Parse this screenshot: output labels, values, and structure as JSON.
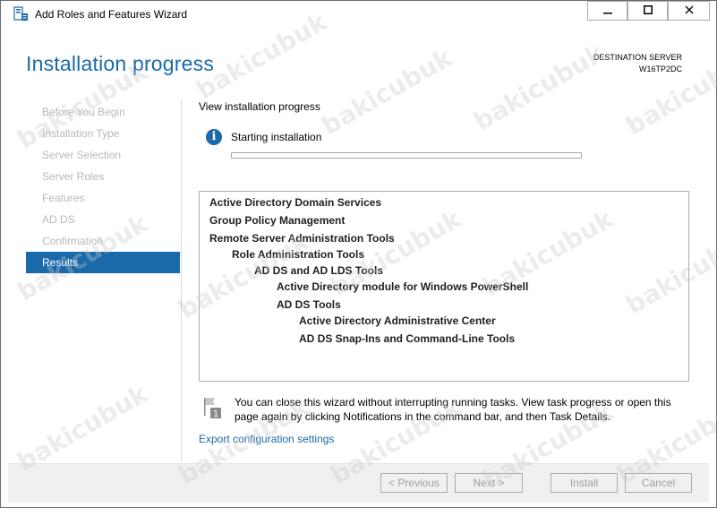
{
  "window": {
    "title": "Add Roles and Features Wizard",
    "minimize_icon": "minimize-icon",
    "maximize_icon": "maximize-icon",
    "close_icon": "close-icon"
  },
  "header": {
    "page_title": "Installation progress",
    "destination_label": "DESTINATION SERVER",
    "destination_server": "W16TP2DC"
  },
  "nav": {
    "items": [
      {
        "label": "Before You Begin",
        "active": false
      },
      {
        "label": "Installation Type",
        "active": false
      },
      {
        "label": "Server Selection",
        "active": false
      },
      {
        "label": "Server Roles",
        "active": false
      },
      {
        "label": "Features",
        "active": false
      },
      {
        "label": "AD DS",
        "active": false
      },
      {
        "label": "Confirmation",
        "active": false
      },
      {
        "label": "Results",
        "active": true
      }
    ]
  },
  "main": {
    "view_label": "View installation progress",
    "status_text": "Starting installation",
    "progress": 0.0,
    "features": [
      {
        "label": "Active Directory Domain Services",
        "level": 0
      },
      {
        "label": "Group Policy Management",
        "level": 0
      },
      {
        "label": "Remote Server Administration Tools",
        "level": 0
      },
      {
        "label": "Role Administration Tools",
        "level": 1
      },
      {
        "label": "AD DS and AD LDS Tools",
        "level": 2
      },
      {
        "label": "Active Directory module for Windows PowerShell",
        "level": 3
      },
      {
        "label": "AD DS Tools",
        "level": 3
      },
      {
        "label": "Active Directory Administrative Center",
        "level": 4
      },
      {
        "label": "AD DS Snap-Ins and Command-Line Tools",
        "level": 4
      }
    ],
    "notice_text": "You can close this wizard without interrupting running tasks. View task progress or open this page again by clicking Notifications in the command bar, and then Task Details.",
    "notice_badge": "1",
    "export_link": "Export configuration settings"
  },
  "footer": {
    "previous_label": "< Previous",
    "next_label": "Next >",
    "install_label": "Install",
    "cancel_label": "Cancel"
  },
  "watermark": "bakicubuk",
  "colors": {
    "accent": "#1a6aab",
    "progress_fill": "#06b025",
    "nav_inactive": "#b8b8b8"
  }
}
